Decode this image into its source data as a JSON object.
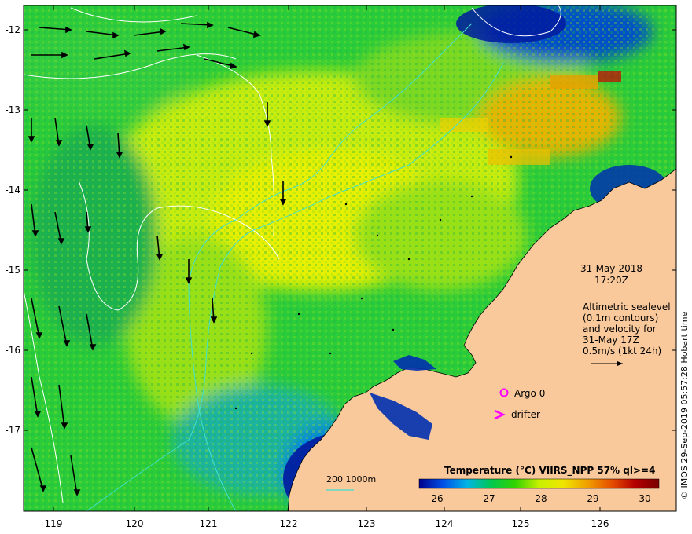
{
  "map": {
    "lat_ticks": [
      "-12",
      "-13",
      "-14",
      "-15",
      "-16",
      "-17"
    ],
    "lon_ticks": [
      "119",
      "120",
      "121",
      "122",
      "123",
      "124",
      "125",
      "126"
    ],
    "lon_range": [
      118.6,
      126.95
    ],
    "lat_range": [
      -17.9,
      -11.85
    ],
    "colors": {
      "land": "#f9c99b",
      "sst_cool": "#1e90e6",
      "sst_mid": "#22c832",
      "sst_warm": "#e6f000",
      "sst_hot": "#e66f00",
      "contour": "#ffffff",
      "bathymetry": "#40e0d0",
      "argo": "#ff00ff",
      "drifter": "#ff00ff",
      "vector": "#000000"
    }
  },
  "annotation": {
    "date": "31-May-2018",
    "time": "17:20Z",
    "altimetry_lines": [
      "Altimetric sealevel",
      "(0.1m contours)",
      "and velocity for",
      "31-May 17Z",
      "0.5m/s (1kt 24h)"
    ],
    "argo_label": "Argo 0",
    "drifter_label": "drifter",
    "bathy_label": "200  1000m"
  },
  "legend": {
    "title": "Temperature (°C) VIIRS_NPP 57% ql>=4",
    "ticks": [
      "26",
      "27",
      "28",
      "29",
      "30"
    ],
    "gradient": [
      "#00008b",
      "#0050e6",
      "#00b4e6",
      "#00c850",
      "#32d200",
      "#c8f000",
      "#f0e600",
      "#f0a000",
      "#e65000",
      "#b40000",
      "#780000"
    ]
  },
  "credit": "© IMOS 29-Sep-2019 05:57:28 Hobart time"
}
